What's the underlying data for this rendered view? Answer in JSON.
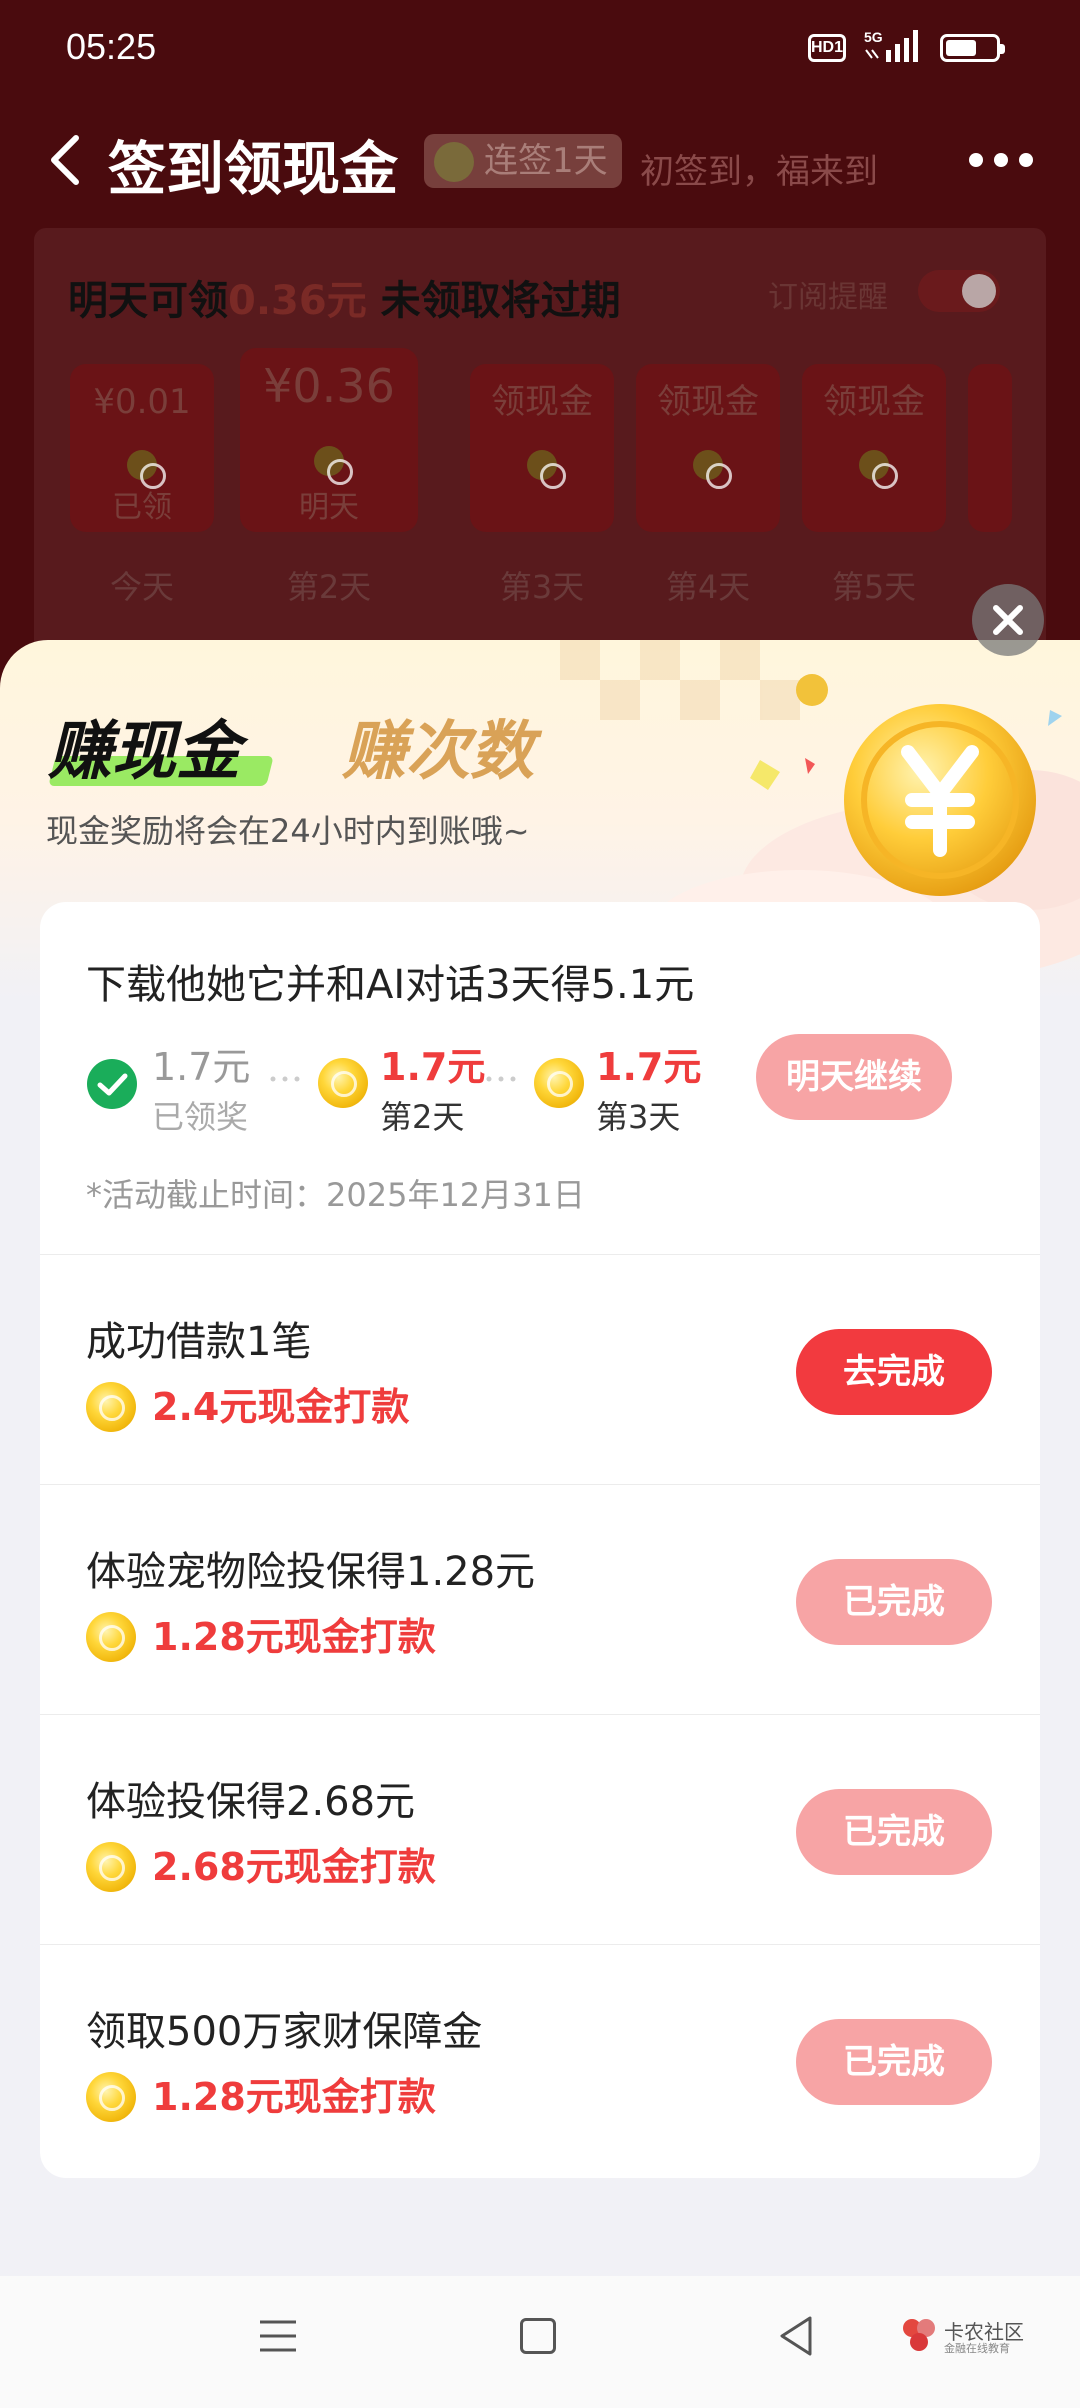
{
  "status_bar": {
    "time": "05:25",
    "hd_label": "HD1",
    "network": "5G"
  },
  "nav": {
    "title": "签到领现金",
    "streak_label": "连签1天",
    "slogan": "初签到，福来到"
  },
  "signin_card": {
    "headline_prefix": "明天可领",
    "headline_amount": "0.36元",
    "headline_suffix": " 未领取将过期",
    "subscribe_label": "订阅提醒",
    "days": [
      {
        "amount": "¥0.01",
        "status": "已领",
        "label": "今天"
      },
      {
        "amount": "¥0.36",
        "status": "明天",
        "label": "第2天"
      },
      {
        "amount": "领现金",
        "status": "",
        "label": "第3天"
      },
      {
        "amount": "领现金",
        "status": "",
        "label": "第4天"
      },
      {
        "amount": "领现金",
        "status": "",
        "label": "第5天"
      }
    ]
  },
  "sheet": {
    "tabs": [
      "赚现金",
      "赚次数"
    ],
    "active_tab": "赚现金",
    "notice": "现金奖励将会在24小时内到账哦~",
    "tasks": [
      {
        "title": "下载他她它并和AI对话3天得5.1元",
        "steps": [
          {
            "amount": "1.7元",
            "label": "已领奖",
            "done": true
          },
          {
            "amount": "1.7元",
            "label": "第2天",
            "done": false
          },
          {
            "amount": "1.7元",
            "label": "第3天",
            "done": false
          }
        ],
        "deadline": "*活动截止时间：2025年12月31日",
        "button": "明天继续"
      },
      {
        "title": "成功借款1笔",
        "reward": "2.4元现金打款",
        "button": "去完成"
      },
      {
        "title": "体验宠物险投保得1.28元",
        "reward": "1.28元现金打款",
        "button": "已完成"
      },
      {
        "title": "体验投保得2.68元",
        "reward": "2.68元现金打款",
        "button": "已完成"
      },
      {
        "title": "领取500万家财保障金",
        "reward": "1.28元现金打款",
        "button": "已完成"
      }
    ]
  },
  "watermark": {
    "name": "卡农社区",
    "tagline": "金融在线教育"
  },
  "colors": {
    "accent_red": "#f23a3f",
    "done_pink": "#f7a4a5",
    "reward_red": "#ef3c3c",
    "check_green": "#1aad5a"
  }
}
